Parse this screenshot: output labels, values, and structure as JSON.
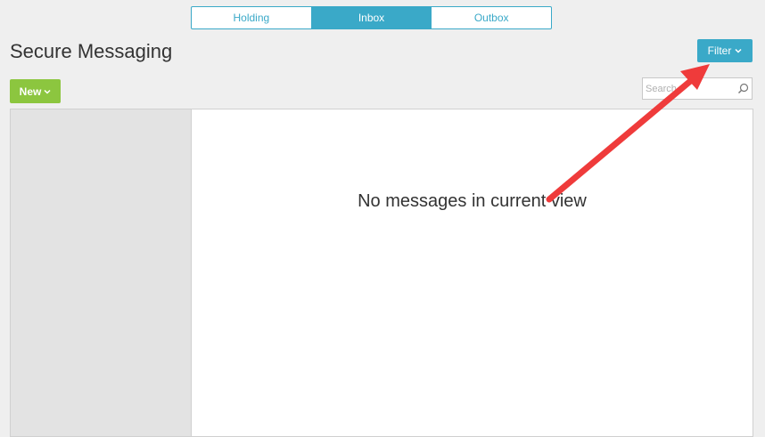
{
  "tabs": [
    {
      "label": "Holding",
      "active": false
    },
    {
      "label": "Inbox",
      "active": true
    },
    {
      "label": "Outbox",
      "active": false
    }
  ],
  "page_title": "Secure Messaging",
  "filter_button": {
    "label": "Filter",
    "icon": "chevron-down-icon"
  },
  "new_button": {
    "label": "New",
    "icon": "chevron-down-icon"
  },
  "search": {
    "placeholder": "Search",
    "value": "",
    "icon": "search-icon"
  },
  "message_view": {
    "empty_text": "No messages in current view"
  },
  "annotation": {
    "type": "arrow",
    "color": "#ef3b3b",
    "points_to": "filter-button"
  },
  "colors": {
    "accent": "#3aa9c8",
    "new_button": "#8cc63f",
    "arrow": "#ef3b3b"
  }
}
